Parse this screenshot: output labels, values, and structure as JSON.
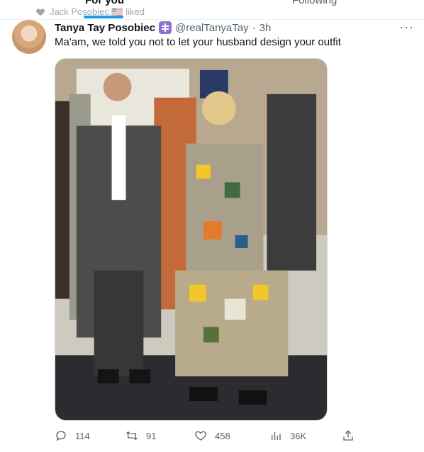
{
  "tabs": {
    "for_you": "For you",
    "following": "Following"
  },
  "social_context": {
    "text": "Jack Posobiec 🇺🇸 liked"
  },
  "tweet": {
    "display_name": "Tanya Tay Posobiec",
    "handle": "@realTanyaTay",
    "separator": "·",
    "time": "3h",
    "more": "···",
    "text": "Ma'am, we told you not to let your husband design your outfit"
  },
  "actions": {
    "replies": "114",
    "reposts": "91",
    "likes": "458",
    "views": "36K"
  },
  "colors": {
    "accent": "#1d9bf0",
    "text_secondary": "#536471",
    "badge": "#8f71d0"
  },
  "icons": [
    "heart-icon",
    "reply-icon",
    "repost-icon",
    "like-icon",
    "views-icon",
    "share-icon",
    "more-icon"
  ]
}
